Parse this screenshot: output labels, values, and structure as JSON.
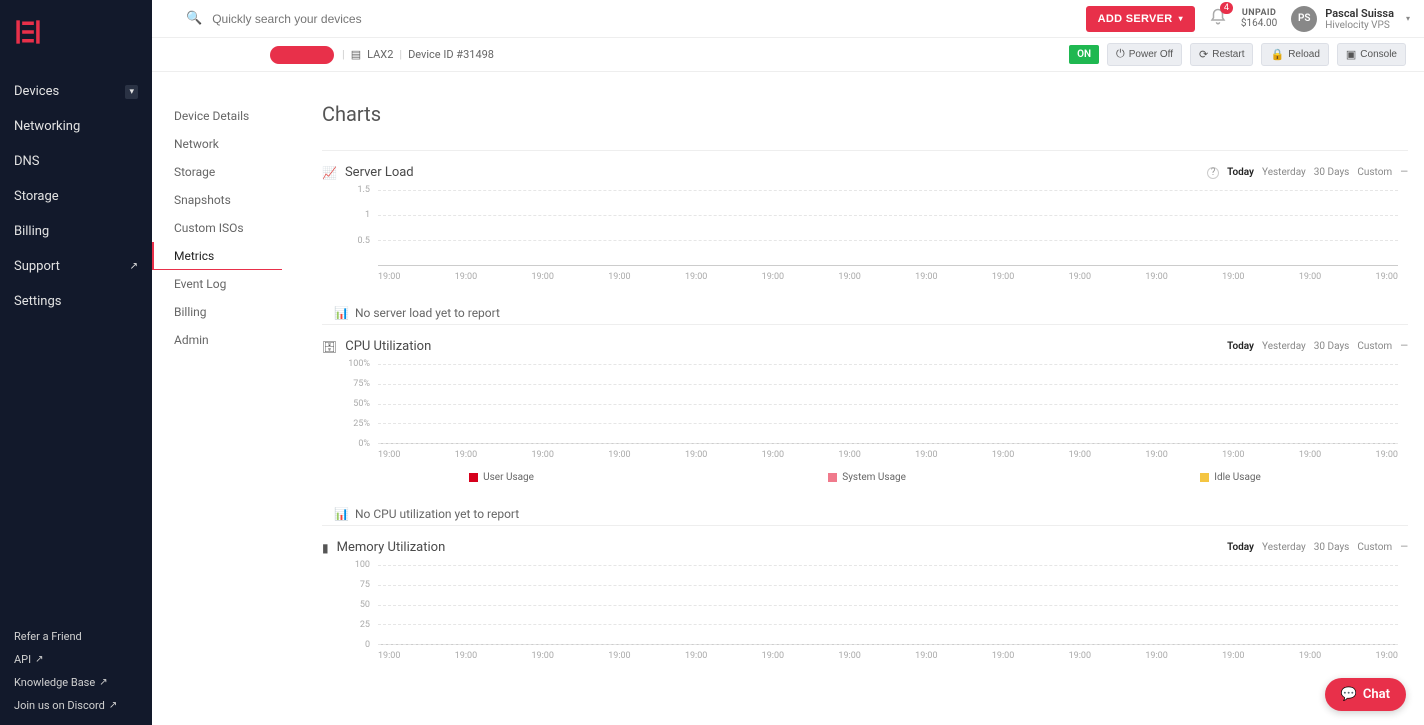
{
  "search": {
    "placeholder": "Quickly search your devices"
  },
  "header": {
    "add_server": "ADD SERVER",
    "notifications": 4,
    "unpaid_label": "UNPAID",
    "unpaid_amount": "$164.00",
    "avatar_initials": "PS",
    "user_name": "Pascal Suissa",
    "user_org": "Hivelocity VPS"
  },
  "sidebar": {
    "items": [
      "Devices",
      "Networking",
      "DNS",
      "Storage",
      "Billing",
      "Support",
      "Settings"
    ],
    "bottom": [
      "Refer a Friend",
      "API",
      "Knowledge Base",
      "Join us on Discord"
    ]
  },
  "device": {
    "location": "LAX2",
    "id_label": "Device ID #31498",
    "status": "ON",
    "actions": [
      "Power Off",
      "Restart",
      "Reload",
      "Console"
    ]
  },
  "subnav": [
    "Device Details",
    "Network",
    "Storage",
    "Snapshots",
    "Custom ISOs",
    "Metrics",
    "Event Log",
    "Billing",
    "Admin"
  ],
  "page_title": "Charts",
  "range_labels": [
    "Today",
    "Yesterday",
    "30 Days",
    "Custom"
  ],
  "charts": {
    "server_load": {
      "title": "Server Load",
      "empty": "No server load yet to report"
    },
    "cpu": {
      "title": "CPU Utilization",
      "empty": "No CPU utilization yet to report",
      "legend": [
        "User Usage",
        "System Usage",
        "Idle Usage"
      ],
      "legend_colors": [
        "#d6001c",
        "#f07a8c",
        "#f4c542"
      ]
    },
    "memory": {
      "title": "Memory Utilization"
    }
  },
  "chat_label": "Chat",
  "chart_data": [
    {
      "type": "line",
      "title": "Server Load",
      "x": [
        "19:00",
        "19:00",
        "19:00",
        "19:00",
        "19:00",
        "19:00",
        "19:00",
        "19:00",
        "19:00",
        "19:00",
        "19:00",
        "19:00",
        "19:00",
        "19:00"
      ],
      "series": [],
      "ylim": [
        0,
        1.5
      ],
      "yticks": [
        0.5,
        1,
        1.5
      ],
      "xlabel": "",
      "ylabel": ""
    },
    {
      "type": "line",
      "title": "CPU Utilization",
      "x": [
        "19:00",
        "19:00",
        "19:00",
        "19:00",
        "19:00",
        "19:00",
        "19:00",
        "19:00",
        "19:00",
        "19:00",
        "19:00",
        "19:00",
        "19:00",
        "19:00"
      ],
      "series": [
        {
          "name": "User Usage",
          "values": []
        },
        {
          "name": "System Usage",
          "values": []
        },
        {
          "name": "Idle Usage",
          "values": []
        }
      ],
      "ylim": [
        0,
        100
      ],
      "yticks": [
        0,
        25,
        50,
        75,
        100
      ],
      "ylabel": "%"
    },
    {
      "type": "line",
      "title": "Memory Utilization",
      "x": [
        "19:00",
        "19:00",
        "19:00",
        "19:00",
        "19:00",
        "19:00",
        "19:00",
        "19:00",
        "19:00",
        "19:00",
        "19:00",
        "19:00",
        "19:00",
        "19:00"
      ],
      "series": [],
      "ylim": [
        0,
        100
      ],
      "yticks": [
        0,
        25,
        50,
        75,
        100
      ],
      "ylabel": ""
    }
  ]
}
